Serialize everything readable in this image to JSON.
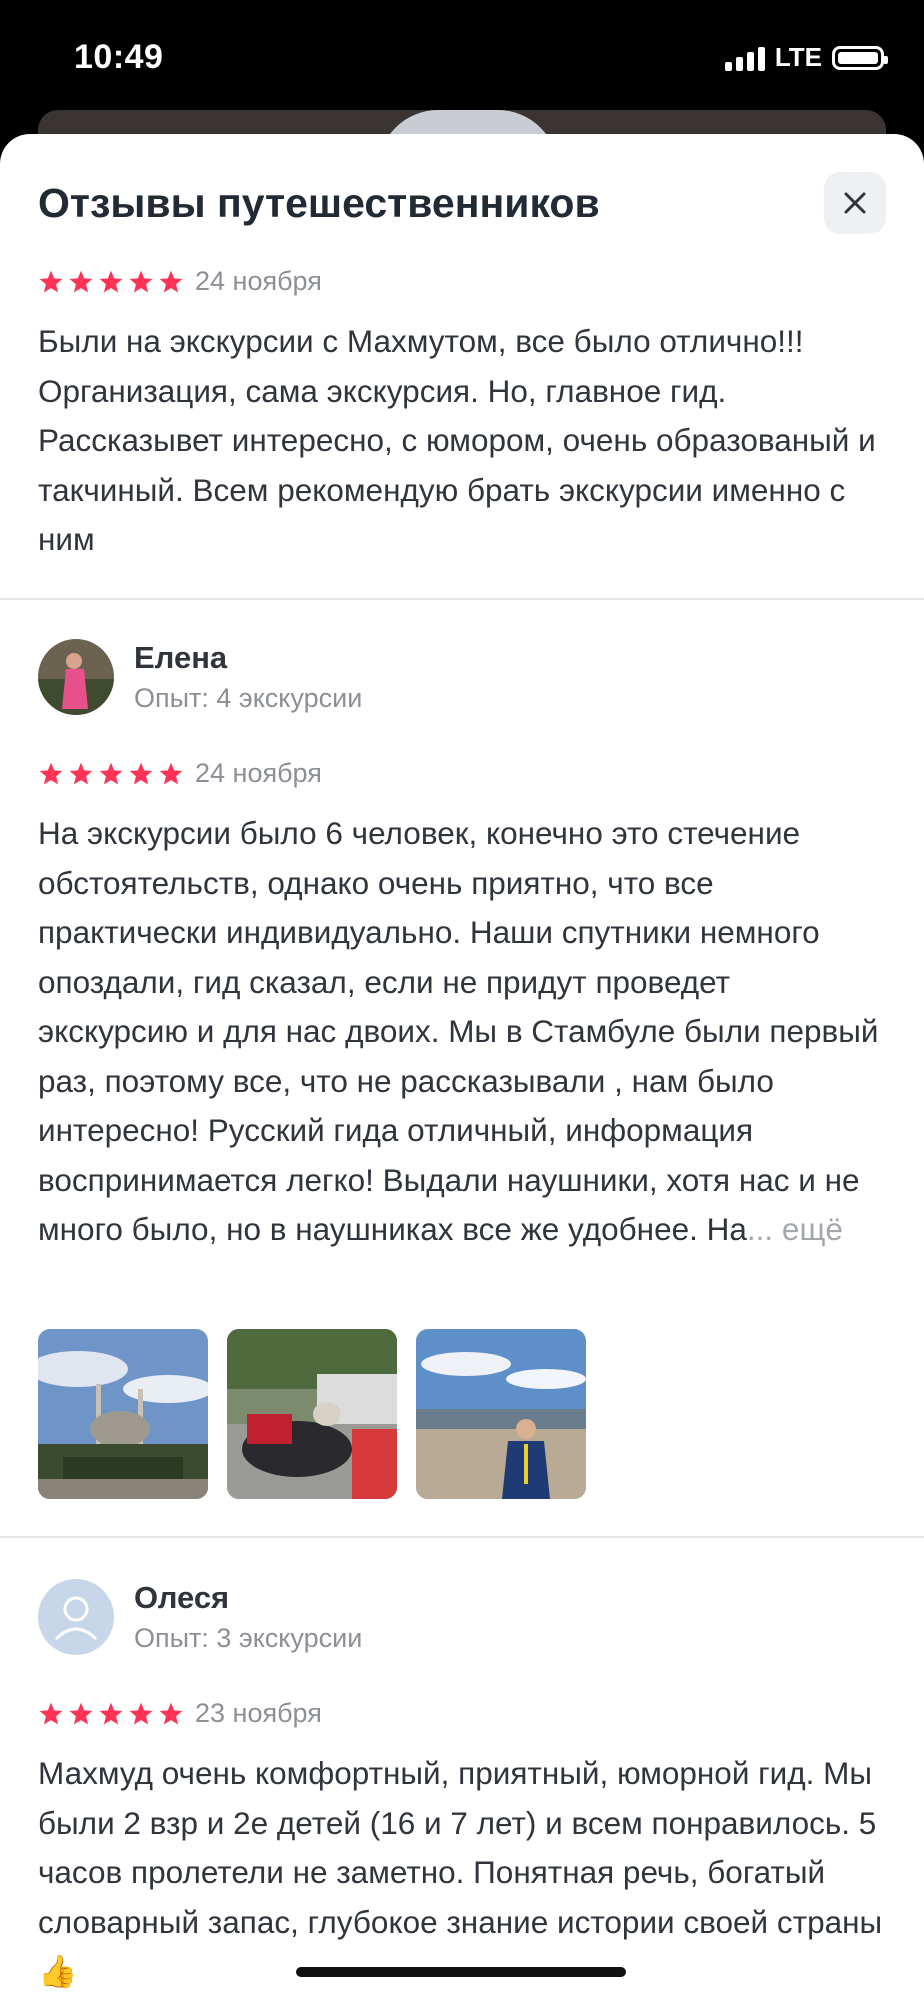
{
  "status_bar": {
    "time": "10:49",
    "network": "LTE"
  },
  "sheet": {
    "title": "Отзывы путешественников"
  },
  "reviews": [
    {
      "date": "24 ноября",
      "text": "Были на экскурсии с Махмутом, все было отлично!!! Организация, сама экскурсия. Но, главное гид. Рассказывет интересно, с юмором, очень образованый и такчиный. Всем рекомендую брать экскурсии именно с ним"
    },
    {
      "author": "Елена",
      "experience": "Опыт: 4 экскурсии",
      "date": "24 ноября",
      "text": "На экскурсии было 6 человек, конечно это стечение обстоятельств, однако очень приятно, что все практически индивидуально. Наши спутники немного опоздали, гид сказал, если не придут проведет экскурсию и для нас двоих. Мы в Стамбуле были первый раз, поэтому все, что не рассказывали , нам было интересно! Русский гида отличный, информация воспринимается легко! Выдали наушники, хотя нас и не много было, но в наушниках все же удобнее. На",
      "ellipsis": "...",
      "more": "ещё"
    },
    {
      "author": "Олеся",
      "experience": "Опыт: 3 экскурсии",
      "date": "23 ноября",
      "text": "Махмуд очень комфортный, приятный, юморной гид. Мы были 2 взр и 2е детей (16 и 7 лет) и всем понравилось. 5 часов пролетели не заметно. Понятная речь, богатый словарный запас, глубокое знание истории своей страны👍"
    }
  ],
  "colors": {
    "star": "#ff3355",
    "title": "#222a36",
    "text": "#30343c",
    "muted": "#8c9096"
  }
}
